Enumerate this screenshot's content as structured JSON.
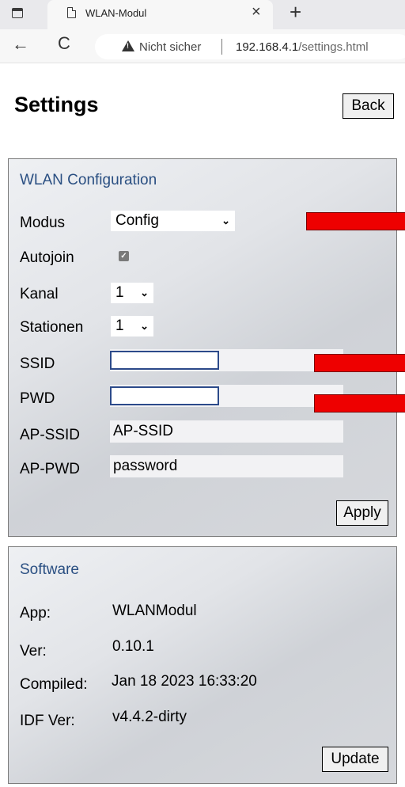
{
  "browser": {
    "tab_title": "WLAN-Modul",
    "tab_close": "×",
    "new_tab": "+",
    "back_glyph": "←",
    "reload_glyph": "C",
    "security_text": "Nicht sicher",
    "url_host": "192.168.4.1",
    "url_path": "/settings.html",
    "icons": [
      "tab-actions-icon",
      "page-icon",
      "close-icon",
      "plus-icon",
      "back-arrow-icon",
      "reload-icon",
      "warning-icon"
    ]
  },
  "page": {
    "title": "Settings",
    "back_label": "Back"
  },
  "wlan": {
    "heading": "WLAN Configuration",
    "modus_label": "Modus",
    "modus_value": "Config",
    "autojoin_label": "Autojoin",
    "autojoin_checked": true,
    "kanal_label": "Kanal",
    "kanal_value": "1",
    "stationen_label": "Stationen",
    "stationen_value": "1",
    "ssid_label": "SSID",
    "pwd_label": "PWD",
    "ap_ssid_label": "AP-SSID",
    "ap_ssid_value": "AP-SSID",
    "ap_pwd_label": "AP-PWD",
    "ap_pwd_value": "password",
    "apply_label": "Apply"
  },
  "software": {
    "heading": "Software",
    "app_label": "App:",
    "app_value": "WLANModul",
    "ver_label": "Ver:",
    "ver_value": "0.10.1",
    "compiled_label": "Compiled:",
    "compiled_value": "Jan 18 2023 16:33:20",
    "idf_label": "IDF Ver:",
    "idf_value": "v4.4.2-dirty",
    "update_label": "Update"
  },
  "colors": {
    "heading_blue": "#2a4f82",
    "redaction_red": "#ee0000",
    "mask_border": "#2c4a8a"
  }
}
